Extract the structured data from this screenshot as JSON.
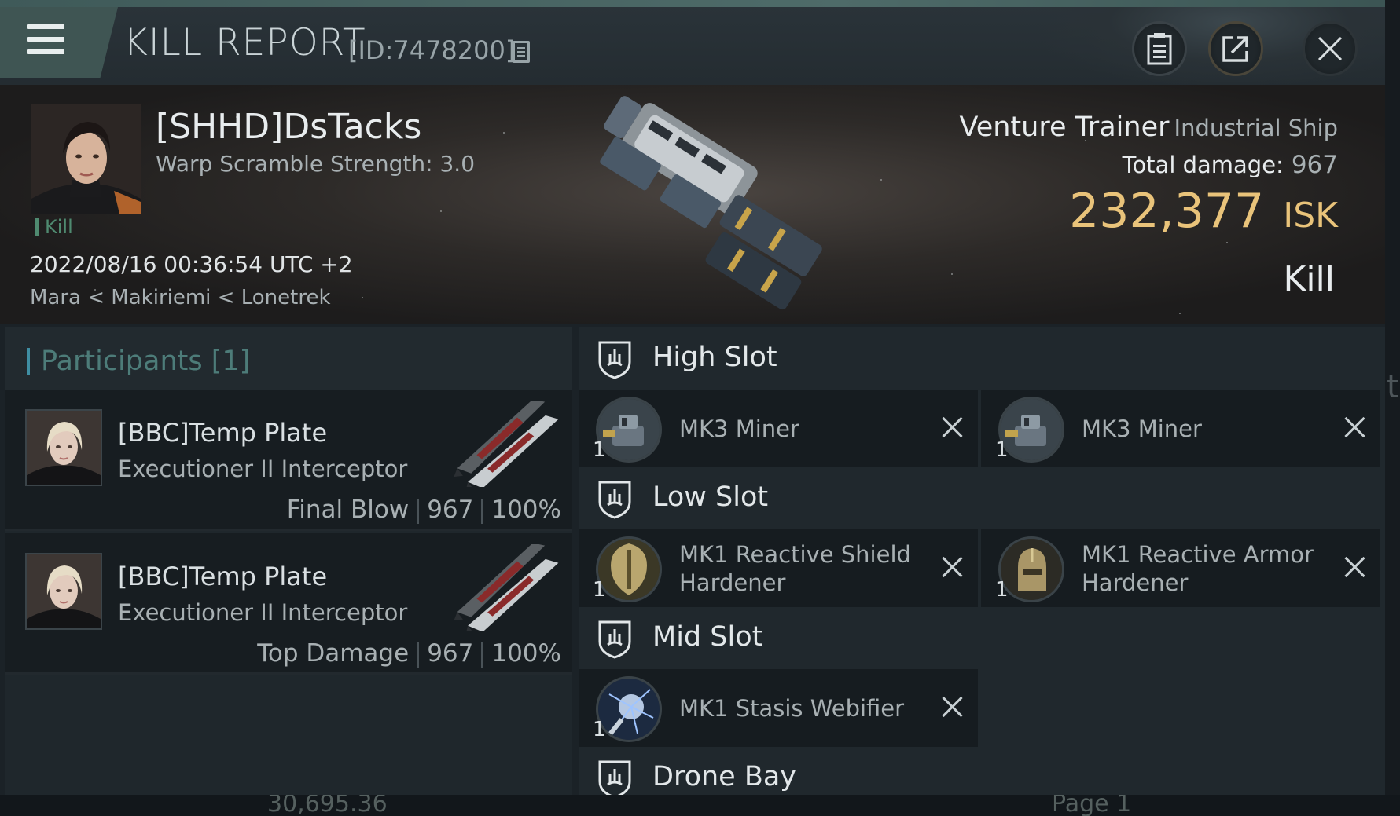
{
  "header": {
    "title": "KILL REPORT",
    "kill_id": "[ID:7478200]"
  },
  "victim": {
    "name": "[SHHD]DsTacks",
    "warp_scramble": "Warp Scramble Strength: 3.0",
    "kill_tag": "Kill",
    "date": "2022/08/16 00:36:54 UTC +2",
    "location": "Mara < Makiriemi < Lonetrek",
    "ship_name": "Venture Trainer",
    "ship_class": "Industrial Ship",
    "damage_label": "Total damage:",
    "damage_value": "967",
    "isk_value": "232,377",
    "isk_unit": "ISK",
    "result": "Kill"
  },
  "participants": {
    "title": "Participants [1]",
    "items": [
      {
        "name": "[BBC]Temp Plate",
        "ship": "Executioner II Interceptor",
        "role": "Final Blow",
        "damage": "967",
        "percent": "100%"
      },
      {
        "name": "[BBC]Temp Plate",
        "ship": "Executioner II Interceptor",
        "role": "Top Damage",
        "damage": "967",
        "percent": "100%"
      }
    ]
  },
  "fitting": {
    "high_slot": {
      "title": "High Slot",
      "modules": [
        {
          "name": "MK3 Miner",
          "qty": "1"
        },
        {
          "name": "MK3 Miner",
          "qty": "1"
        }
      ]
    },
    "low_slot": {
      "title": "Low Slot",
      "modules": [
        {
          "name": "MK1 Reactive Shield Hardener",
          "qty": "1"
        },
        {
          "name": "MK1 Reactive Armor Hardener",
          "qty": "1"
        }
      ]
    },
    "mid_slot": {
      "title": "Mid Slot",
      "modules": [
        {
          "name": "MK1 Stasis Webifier",
          "qty": "1"
        }
      ]
    },
    "drone_bay": {
      "title": "Drone Bay"
    }
  },
  "background": {
    "partial_value": "30,695.36",
    "partial_page": "Page 1",
    "partial_edge_text": "t"
  },
  "colors": {
    "accent": "#4f8a70",
    "isk": "#e9c37a",
    "participants_title": "#4d7c79"
  }
}
